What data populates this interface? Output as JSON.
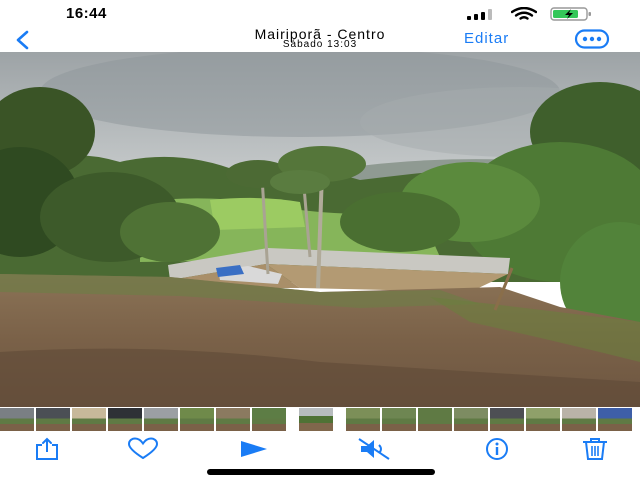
{
  "status_bar": {
    "time": "16:44",
    "signal_icon": "cellular-signal-icon",
    "wifi_icon": "wifi-icon",
    "battery_icon": "battery-charging-icon"
  },
  "nav": {
    "back_icon": "chevron-left-icon",
    "title": "Mairiporã - Centro",
    "subtitle": "Sábado 13:03",
    "edit_label": "Editar",
    "more_icon": "ellipsis-circle-icon"
  },
  "photo": {
    "content": "landscape-photo"
  },
  "thumbnails": {
    "count": 17,
    "selected_index": 8
  },
  "toolbar": {
    "share_icon": "share-icon",
    "favorite_icon": "heart-icon",
    "play_icon": "play-icon",
    "mute_icon": "speaker-muted-icon",
    "info_icon": "info-icon",
    "delete_icon": "trash-icon"
  },
  "colors": {
    "accent": "#1a7cf5",
    "battery": "#34c759"
  }
}
